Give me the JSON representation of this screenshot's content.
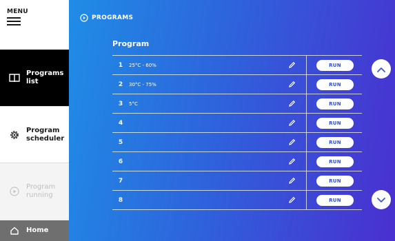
{
  "sidebar": {
    "menu_label": "MENU",
    "items": [
      {
        "label": "Programs\nlist",
        "icon": "book-icon",
        "state": "active"
      },
      {
        "label": "Program\nscheduler",
        "icon": "gear-icon",
        "state": "normal"
      },
      {
        "label": "Program\nrunning",
        "icon": "play-circle-icon",
        "state": "disabled"
      },
      {
        "label": "Home",
        "icon": "home-icon",
        "state": "normal"
      }
    ]
  },
  "header": {
    "breadcrumb": "PROGRAMS"
  },
  "program_table": {
    "title": "Program",
    "run_label": "RUN",
    "rows": [
      {
        "number": "1",
        "name": "25°C - 60%"
      },
      {
        "number": "2",
        "name": "30°C - 75%"
      },
      {
        "number": "3",
        "name": "5°C"
      },
      {
        "number": "4",
        "name": ""
      },
      {
        "number": "5",
        "name": ""
      },
      {
        "number": "6",
        "name": ""
      },
      {
        "number": "7",
        "name": ""
      },
      {
        "number": "8",
        "name": ""
      }
    ]
  },
  "colors": {
    "gradient_start": "#1f8de6",
    "gradient_end": "#4a2fd0",
    "active_nav": "#000000",
    "run_text": "#2f4fcf"
  }
}
